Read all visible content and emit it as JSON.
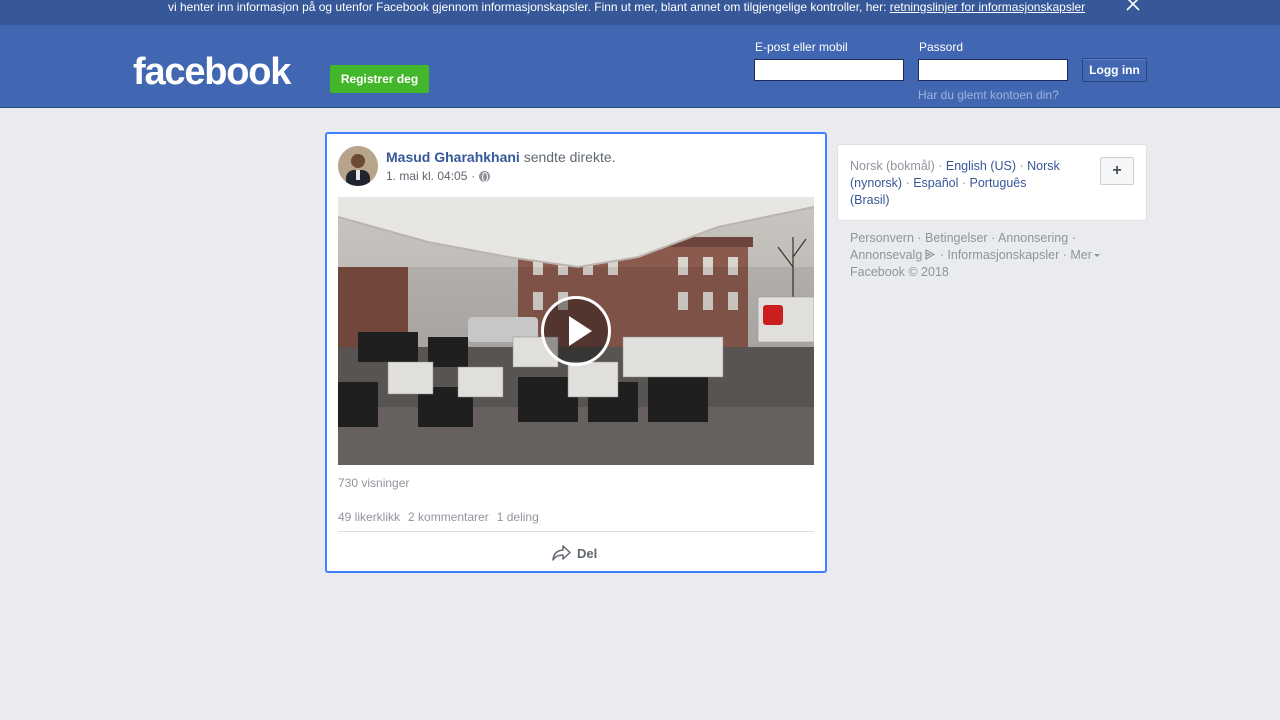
{
  "cookie_banner": {
    "text": "vi henter inn informasjon på og utenfor Facebook gjennom informasjonskapsler. Finn ut mer, blant annet om tilgjengelige kontroller, her: ",
    "link": "retningslinjer for informasjonskapsler"
  },
  "header": {
    "logo": "facebook",
    "register_label": "Registrer deg",
    "email_label": "E-post eller mobil",
    "password_label": "Passord",
    "email_value": "",
    "password_value": "",
    "login_label": "Logg inn",
    "forgot_label": "Har du glemt kontoen din?"
  },
  "post": {
    "author": "Masud Gharahkhani",
    "action": "sendte direkte.",
    "date": "1. mai kl. 04:05",
    "separator": "·",
    "views": "730 visninger",
    "likes": "49 likerklikk",
    "comments": "2 kommentarer",
    "shares": "1 deling",
    "share_label": "Del"
  },
  "languages": {
    "current": "Norsk (bokmål)",
    "items": [
      "English (US)",
      "Norsk (nynorsk)",
      "Español",
      "Português (Brasil)"
    ],
    "add_label": "+"
  },
  "footer": {
    "links": [
      "Personvern",
      "Betingelser",
      "Annonsering",
      "Annonsevalg",
      "Informasjonskapsler",
      "Mer"
    ],
    "copyright": "Facebook © 2018"
  },
  "colors": {
    "brand": "#4267b2",
    "banner": "#365899",
    "register": "#42b72a",
    "link": "#365899",
    "focus": "#4080ff"
  }
}
